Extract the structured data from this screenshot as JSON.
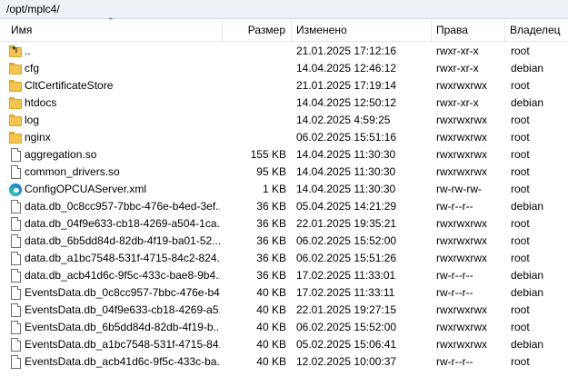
{
  "path": "/opt/mplc4/",
  "columns": {
    "name": "Имя",
    "size": "Размер",
    "modified": "Изменено",
    "permissions": "Права",
    "owner": "Владелец"
  },
  "rows": [
    {
      "icon": "up-folder-icon",
      "name": "..",
      "size": "",
      "modified": "21.01.2025 17:12:16",
      "permissions": "rwxr-xr-x",
      "owner": "root"
    },
    {
      "icon": "folder-icon",
      "name": "cfg",
      "size": "",
      "modified": "14.04.2025 12:46:12",
      "permissions": "rwxr-xr-x",
      "owner": "debian"
    },
    {
      "icon": "folder-icon",
      "name": "CltCertificateStore",
      "size": "",
      "modified": "21.01.2025 17:19:14",
      "permissions": "rwxrwxrwx",
      "owner": "root"
    },
    {
      "icon": "folder-icon",
      "name": "htdocs",
      "size": "",
      "modified": "14.04.2025 12:50:12",
      "permissions": "rwxr-xr-x",
      "owner": "debian"
    },
    {
      "icon": "folder-icon",
      "name": "log",
      "size": "",
      "modified": "14.02.2025 4:59:25",
      "permissions": "rwxrwxrwx",
      "owner": "root"
    },
    {
      "icon": "folder-icon",
      "name": "nginx",
      "size": "",
      "modified": "06.02.2025 15:51:16",
      "permissions": "rwxrwxrwx",
      "owner": "root"
    },
    {
      "icon": "file-icon",
      "name": "aggregation.so",
      "size": "155 KB",
      "modified": "14.04.2025 11:30:30",
      "permissions": "rwxrwxrwx",
      "owner": "root"
    },
    {
      "icon": "file-icon",
      "name": "common_drivers.so",
      "size": "95 KB",
      "modified": "14.04.2025 11:30:30",
      "permissions": "rwxrwxrwx",
      "owner": "root"
    },
    {
      "icon": "edge-icon",
      "name": "ConfigOPCUAServer.xml",
      "size": "1 KB",
      "modified": "14.04.2025 11:30:30",
      "permissions": "rw-rw-rw-",
      "owner": "root"
    },
    {
      "icon": "file-icon",
      "name": "data.db_0c8cc957-7bbc-476e-b4ed-3ef...",
      "size": "36 KB",
      "modified": "05.04.2025 14:21:29",
      "permissions": "rw-r--r--",
      "owner": "debian"
    },
    {
      "icon": "file-icon",
      "name": "data.db_04f9e633-cb18-4269-a504-1ca...",
      "size": "36 KB",
      "modified": "22.01.2025 19:35:21",
      "permissions": "rwxrwxrwx",
      "owner": "root"
    },
    {
      "icon": "file-icon",
      "name": "data.db_6b5dd84d-82db-4f19-ba01-52...",
      "size": "36 KB",
      "modified": "06.02.2025 15:52:00",
      "permissions": "rwxrwxrwx",
      "owner": "root"
    },
    {
      "icon": "file-icon",
      "name": "data.db_a1bc7548-531f-4715-84c2-824...",
      "size": "36 KB",
      "modified": "06.02.2025 15:51:26",
      "permissions": "rwxrwxrwx",
      "owner": "root"
    },
    {
      "icon": "file-icon",
      "name": "data.db_acb41d6c-9f5c-433c-bae8-9b4...",
      "size": "36 KB",
      "modified": "17.02.2025 11:33:01",
      "permissions": "rw-r--r--",
      "owner": "debian"
    },
    {
      "icon": "file-icon",
      "name": "EventsData.db_0c8cc957-7bbc-476e-b4...",
      "size": "40 KB",
      "modified": "17.02.2025 11:33:11",
      "permissions": "rw-r--r--",
      "owner": "debian"
    },
    {
      "icon": "file-icon",
      "name": "EventsData.db_04f9e633-cb18-4269-a5...",
      "size": "40 KB",
      "modified": "22.01.2025 19:27:15",
      "permissions": "rwxrwxrwx",
      "owner": "root"
    },
    {
      "icon": "file-icon",
      "name": "EventsData.db_6b5dd84d-82db-4f19-b...",
      "size": "40 KB",
      "modified": "06.02.2025 15:52:00",
      "permissions": "rwxrwxrwx",
      "owner": "root"
    },
    {
      "icon": "file-icon",
      "name": "EventsData.db_a1bc7548-531f-4715-84...",
      "size": "40 KB",
      "modified": "05.02.2025 15:06:41",
      "permissions": "rwxrwxrwx",
      "owner": "debian"
    },
    {
      "icon": "file-icon",
      "name": "EventsData.db_acb41d6c-9f5c-433c-ba...",
      "size": "40 KB",
      "modified": "12.02.2025 10:00:37",
      "permissions": "rw-r--r--",
      "owner": "root"
    }
  ]
}
